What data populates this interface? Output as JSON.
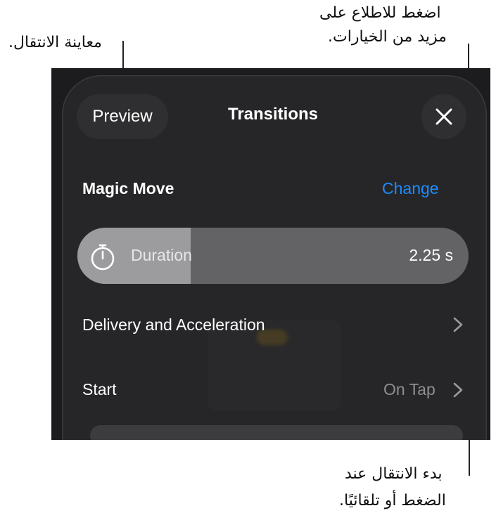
{
  "callouts": {
    "preview": "معاينة الانتقال.",
    "options_line1": "اضغط للاطلاع على",
    "options_line2": "مزيد من الخيارات.",
    "start_line1": "بدء الانتقال عند",
    "start_line2": "الضغط أو تلقائيًا."
  },
  "header": {
    "preview_label": "Preview",
    "title": "Transitions",
    "close_icon": "close-icon"
  },
  "effect": {
    "name": "Magic Move",
    "change_label": "Change"
  },
  "duration": {
    "label": "Duration",
    "value": "2.25 s",
    "fill_fraction": 0.29,
    "icon": "stopwatch-icon"
  },
  "rows": {
    "delivery_label": "Delivery and Acceleration",
    "start_label": "Start",
    "start_value": "On Tap"
  },
  "colors": {
    "accent": "#1e8cff",
    "panel_bg": "#262628",
    "screen_bg": "#1c1c1e"
  }
}
